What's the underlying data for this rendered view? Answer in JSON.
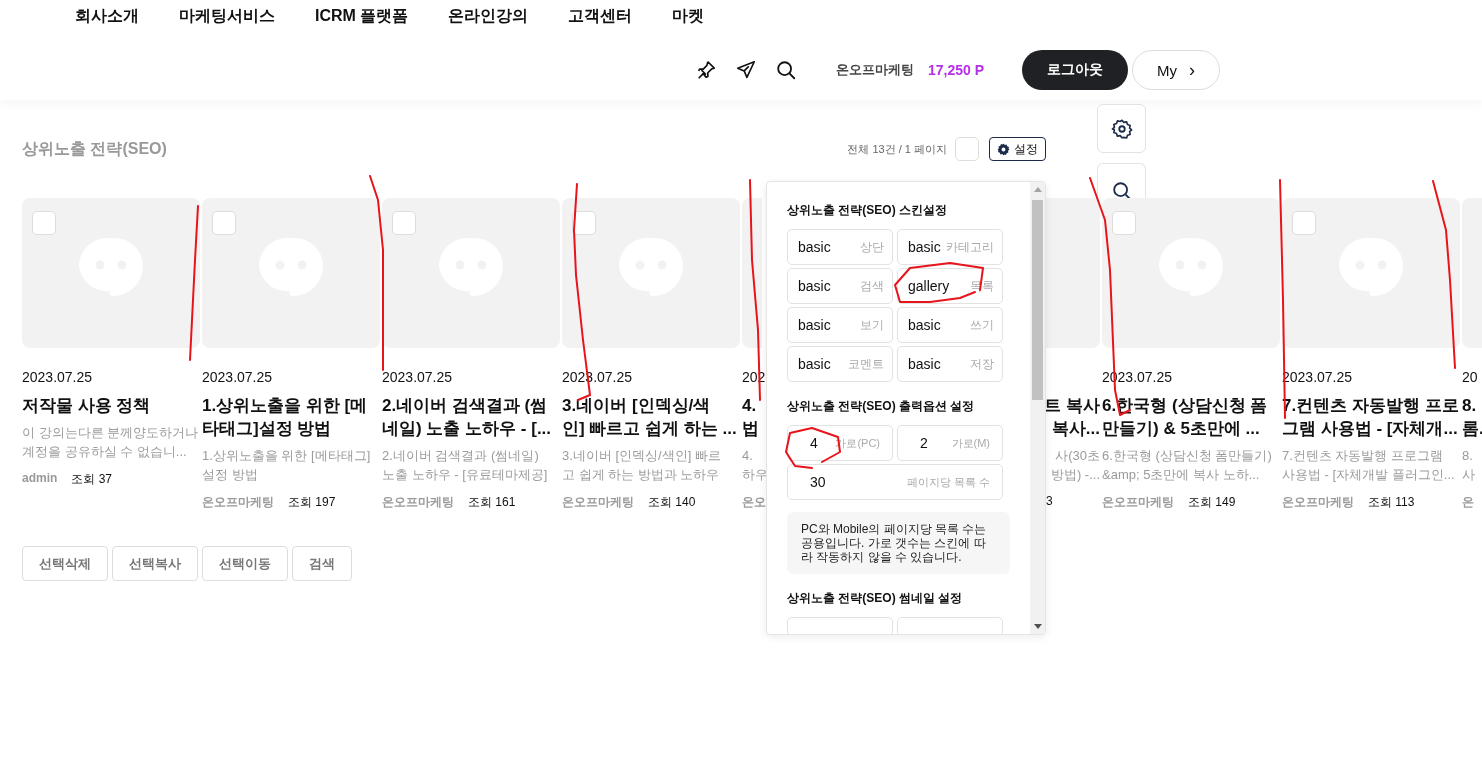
{
  "nav": [
    "회사소개",
    "마케팅서비스",
    "ICRM 플랫폼",
    "온라인강의",
    "고객센터",
    "마켓"
  ],
  "header": {
    "member": "온오프마케팅",
    "points": "17,250 P",
    "logout": "로그아웃",
    "my": "My",
    "my_arrow": "›"
  },
  "board": {
    "title": "상위노출 전략(SEO)",
    "count": "전체 13건 / 1 페이지",
    "select_all_checked": false,
    "settings": "설정"
  },
  "cards": [
    {
      "kind": "full",
      "checked": false,
      "date": "2023.07.25",
      "title_lines": [
        "저작물 사용 정책"
      ],
      "summary_lines": [
        "이 강의는다른 분께양도하거나",
        "계정을 공유하실 수 없습니..."
      ],
      "author": "admin",
      "views": "조회 37"
    },
    {
      "kind": "full",
      "checked": false,
      "date": "2023.07.25",
      "title_lines": [
        "1.상위노출을 위한 [메",
        "타태그]설정 방법"
      ],
      "summary_lines": [
        "1.상위노출을 위한 [메타태그]",
        "설정 방법"
      ],
      "author": "온오프마케팅",
      "views": "조회 197"
    },
    {
      "kind": "full",
      "checked": false,
      "date": "2023.07.25",
      "title_lines": [
        "2.네이버 검색결과 (썸",
        "네일) 노출 노하우 - [..."
      ],
      "summary_lines": [
        "2.네이버 검색결과 (썸네일)",
        "노출 노하우 - [유료테마제공]"
      ],
      "author": "온오프마케팅",
      "views": "조회 161"
    },
    {
      "kind": "full",
      "checked": false,
      "date": "2023.07.25",
      "title_lines": [
        "3.네이버 [인덱싱/색",
        "인] 빠르고 쉽게 하는 ..."
      ],
      "summary_lines": [
        "3.네이버 [인덱싱/색인] 빠르",
        "고 쉽게 하는 방법과 노하우"
      ],
      "author": "온오프마케팅",
      "views": "조회 140"
    },
    {
      "kind": "clip_right",
      "date": "202",
      "title_lines": [
        "4.",
        "법"
      ],
      "summary_lines": [
        "4.",
        "하우"
      ],
      "author": "온오"
    },
    {
      "kind": "clip_left",
      "title_lines": [
        "트 복사",
        "복사..."
      ],
      "summary_lines": [
        "사(30초",
        "방법) -..."
      ],
      "views": "3"
    },
    {
      "kind": "full",
      "checked": false,
      "date": "2023.07.25",
      "title_lines": [
        "6.한국형 (상담신청 폼",
        "만들기) & 5초만에 ..."
      ],
      "summary_lines": [
        "6.한국형 (상담신청 폼만들기)",
        "&amp; 5초만에 복사 노하..."
      ],
      "author": "온오프마케팅",
      "views": "조회 149"
    },
    {
      "kind": "full",
      "checked": false,
      "date": "2023.07.25",
      "title_lines": [
        "7.컨텐츠 자동발행 프로",
        "그램 사용법 - [자체개..."
      ],
      "summary_lines": [
        "7.컨텐츠 자동발행 프로그램",
        "사용법 - [자체개발 플러그인..."
      ],
      "author": "온오프마케팅",
      "views": "조회 113"
    },
    {
      "kind": "clip_right",
      "date": "20",
      "title_lines": [
        "8.",
        "롬."
      ],
      "summary_lines": [
        "8.",
        "사"
      ],
      "author": "온"
    }
  ],
  "actions": [
    "선택삭제",
    "선택복사",
    "선택이동",
    "검색"
  ],
  "panel": {
    "sections": [
      {
        "kind": "skins",
        "heading": "상위노출 전략(SEO) 스킨설정",
        "options": [
          {
            "value": "basic",
            "label": "상단"
          },
          {
            "value": "basic",
            "label": "카테고리"
          },
          {
            "value": "basic",
            "label": "검색"
          },
          {
            "value": "gallery",
            "label": "목록"
          },
          {
            "value": "basic",
            "label": "보기"
          },
          {
            "value": "basic",
            "label": "쓰기"
          },
          {
            "value": "basic",
            "label": "코멘트"
          },
          {
            "value": "basic",
            "label": "저장"
          }
        ]
      },
      {
        "kind": "output",
        "heading": "상위노출 전략(SEO) 출력옵션 설정",
        "fields": [
          {
            "value": "4",
            "label": "가로(PC)",
            "wide": false
          },
          {
            "value": "2",
            "label": "가로(M)",
            "wide": false
          },
          {
            "value": "30",
            "label": "페이지당 목록 수",
            "wide": true
          }
        ],
        "note": "PC와 Mobile의 페이지당 목록 수는 공용입니다. 가로 갯수는 스킨에 따라 작동하지 않을 수 있습니다."
      },
      {
        "kind": "thumbs",
        "heading": "상위노출 전략(SEO) 썸네일 설정"
      }
    ]
  }
}
